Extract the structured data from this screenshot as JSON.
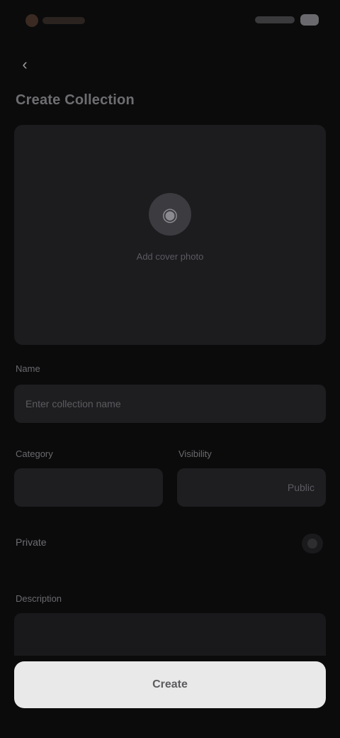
{
  "header": {
    "back_icon": "chevron-left-icon",
    "title": "Create Collection"
  },
  "photo": {
    "icon": "camera-icon",
    "label": "Add cover photo"
  },
  "form": {
    "name_label": "Name",
    "name_placeholder": "Enter collection name",
    "category_label": "Category",
    "category_value": "",
    "visibility_label": "Visibility",
    "visibility_value": "Public",
    "private_toggle_label": "Private",
    "description_label": "Description"
  },
  "actions": {
    "submit_label": "Create"
  },
  "colors": {
    "background": "#0b0b0c",
    "card": "#1c1c1f",
    "button": "#e9e9ea"
  }
}
